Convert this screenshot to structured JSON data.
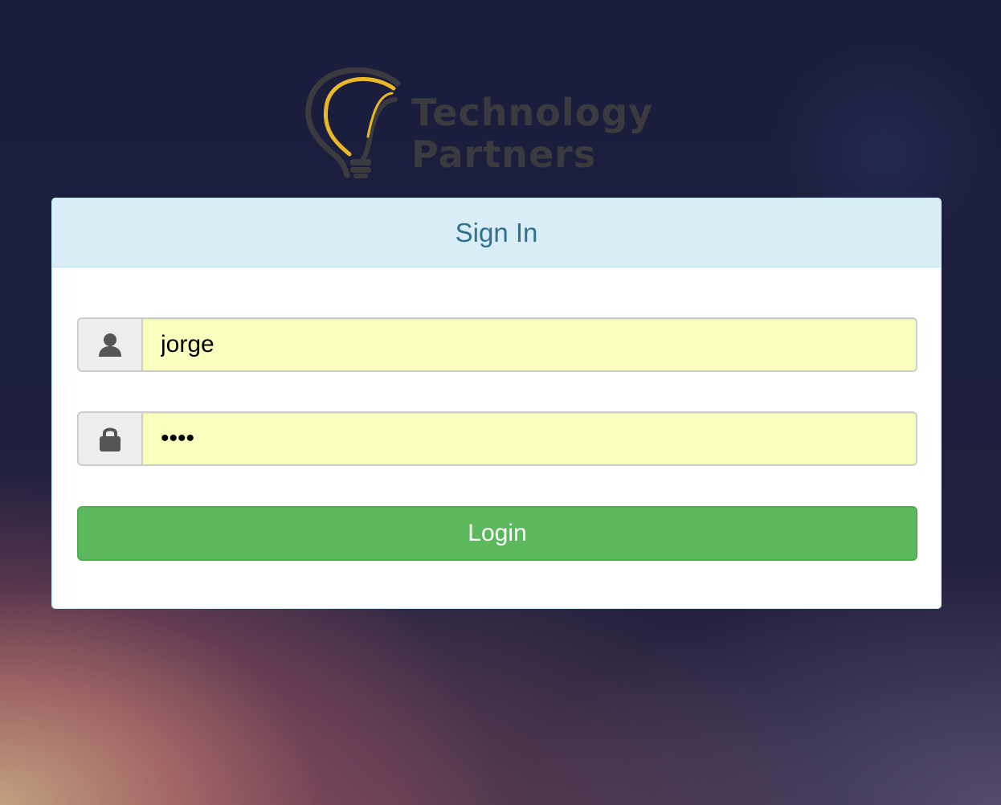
{
  "logo": {
    "line1": "Technology",
    "line2": "Partners",
    "icon": "lightbulb-icon"
  },
  "panel": {
    "title": "Sign In"
  },
  "form": {
    "username": {
      "icon": "user-icon",
      "value": "jorge"
    },
    "password": {
      "icon": "lock-icon",
      "value": "jorg"
    },
    "submit_label": "Login"
  },
  "colors": {
    "panel_heading_bg": "#d9edf7",
    "panel_title": "#31708f",
    "autofill_bg": "#faffbd",
    "button_success": "#5cb85c",
    "logo_accent": "#e8b827",
    "logo_text": "#3b3b3f"
  }
}
